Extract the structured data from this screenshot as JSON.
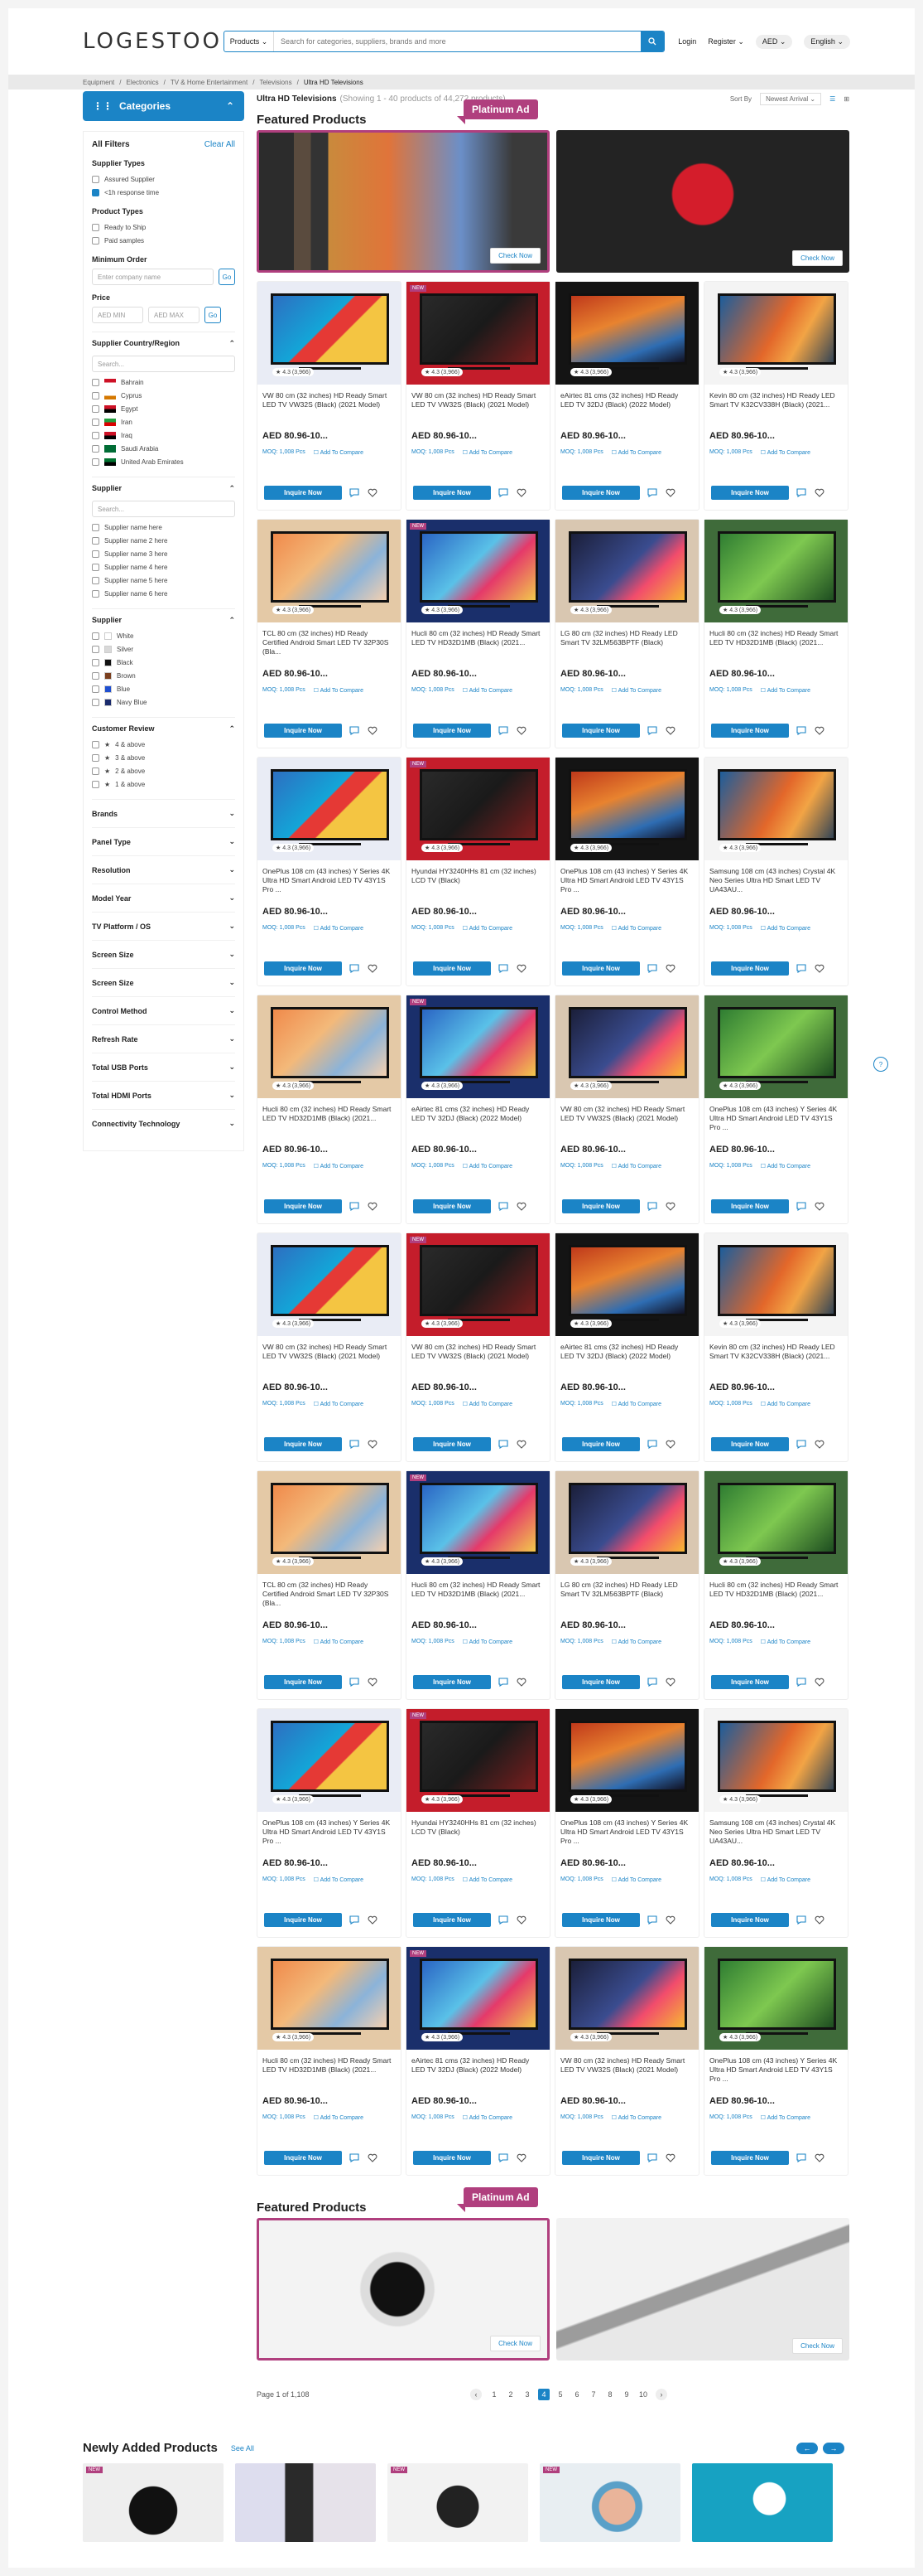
{
  "header": {
    "logo": "LOGESTOO",
    "search_scope": "Products",
    "search_placeholder": "Search for categories, suppliers, brands and more",
    "login": "Login",
    "register": "Register",
    "currency": "AED",
    "language": "English"
  },
  "breadcrumb": [
    "Equipment",
    "Electronics",
    "TV & Home Entertainment",
    "Televisions",
    "Ultra HD Televisions"
  ],
  "sidebar": {
    "categories": "Categories",
    "all_filters": "All Filters",
    "clear_all": "Clear All",
    "supplier_types": {
      "title": "Supplier Types",
      "items": [
        "Assured Supplier",
        "<1h response time"
      ]
    },
    "product_types": {
      "title": "Product Types",
      "items": [
        "Ready to Ship",
        "Paid samples"
      ]
    },
    "min_order": {
      "title": "Minimum Order",
      "placeholder": "Enter company name",
      "go": "Go"
    },
    "price": {
      "title": "Price",
      "min": "AED MIN",
      "max": "AED MAX",
      "go": "Go"
    },
    "country": {
      "title": "Supplier Country/Region",
      "search": "Search...",
      "items": [
        {
          "name": "Bahrain",
          "c1": "#ce1126",
          "c2": "#fff"
        },
        {
          "name": "Cyprus",
          "c1": "#fff",
          "c2": "#d57800"
        },
        {
          "name": "Egypt",
          "c1": "#ce1126",
          "c2": "#000"
        },
        {
          "name": "Iran",
          "c1": "#239f40",
          "c2": "#da0000"
        },
        {
          "name": "Iraq",
          "c1": "#ce1126",
          "c2": "#000"
        },
        {
          "name": "Saudi Arabia",
          "c1": "#006c35",
          "c2": "#006c35"
        },
        {
          "name": "United Arab Emirates",
          "c1": "#00732f",
          "c2": "#000"
        }
      ]
    },
    "supplier": {
      "title": "Supplier",
      "search": "Search...",
      "items": [
        "Supplier name here",
        "Supplier name 2 here",
        "Supplier name 3 here",
        "Supplier name 4 here",
        "Supplier name 5 here",
        "Supplier name 6 here"
      ]
    },
    "color": {
      "title": "Supplier",
      "items": [
        {
          "name": "White",
          "hex": "#ffffff"
        },
        {
          "name": "Silver",
          "hex": "#d9d9d9"
        },
        {
          "name": "Black",
          "hex": "#111111"
        },
        {
          "name": "Brown",
          "hex": "#7b3f1e"
        },
        {
          "name": "Blue",
          "hex": "#1f4fd1"
        },
        {
          "name": "Navy Blue",
          "hex": "#1a2a6c"
        }
      ]
    },
    "review": {
      "title": "Customer Review",
      "items": [
        "4 & above",
        "3 & above",
        "2 & above",
        "1 & above"
      ]
    },
    "collapsed": [
      "Brands",
      "Panel Type",
      "Resolution",
      "Model Year",
      "TV Platform / OS",
      "Screen Size",
      "Screen Size",
      "Control Method",
      "Refresh Rate",
      "Total USB Ports",
      "Total HDMI Ports",
      "Connectivity Technology"
    ]
  },
  "main": {
    "title": "Ultra HD Televisions",
    "count": "(Showing 1 - 40 products of 44,272 products)",
    "sort_label": "Sort By",
    "sort_value": "Newest Arrival",
    "featured": "Featured Products",
    "platinum": "Platinum Ad",
    "check_now": "Check Now",
    "inquire": "Inquire Now",
    "moq": "MOQ: 1,008 Pcs",
    "compare": "Add To Compare",
    "rating": "4.3 (3,966)",
    "new_badge": "NEW",
    "price": "AED 80.96-10..."
  },
  "products": [
    "VW 80 cm (32 inches) HD Ready Smart LED TV VW32S (Black) (2021 Model)",
    "VW 80 cm (32 inches) HD Ready Smart LED TV VW32S (Black) (2021 Model)",
    "eAirtec 81 cms (32 inches) HD Ready LED TV 32DJ (Black) (2022 Model)",
    "Kevin 80 cm (32 inches) HD Ready LED Smart TV K32CV338H (Black) (2021...",
    "TCL 80 cm (32 inches) HD Ready Certified Android Smart LED TV 32P30S (Bla...",
    "Hucli 80 cm (32 inches) HD Ready Smart LED TV HD32D1MB (Black) (2021...",
    "LG 80 cm (32 inches) HD Ready LED Smart TV 32LM563BPTF (Black)",
    "Hucli 80 cm (32 inches) HD Ready Smart LED TV HD32D1MB (Black) (2021...",
    "OnePlus 108 cm (43 inches) Y Series 4K Ultra HD Smart Android LED TV 43Y1S Pro ...",
    "Hyundai HY3240HHs 81 cm (32 inches) LCD TV (Black)",
    "OnePlus 108 cm (43 inches) Y Series 4K Ultra HD Smart Android LED TV 43Y1S Pro ...",
    "Samsung 108 cm (43 inches) Crystal 4K Neo Series Ultra HD Smart LED TV UA43AU...",
    "Hucli 80 cm (32 inches) HD Ready Smart LED TV HD32D1MB (Black) (2021...",
    "eAirtec 81 cms (32 inches) HD Ready LED TV 32DJ (Black) (2022 Model)",
    "VW 80 cm (32 inches) HD Ready Smart LED TV VW32S (Black) (2021 Model)",
    "OnePlus 108 cm (43 inches) Y Series 4K Ultra HD Smart Android LED TV 43Y1S Pro ...",
    "VW 80 cm (32 inches) HD Ready Smart LED TV VW32S (Black) (2021 Model)",
    "VW 80 cm (32 inches) HD Ready Smart LED TV VW32S (Black) (2021 Model)",
    "eAirtec 81 cms (32 inches) HD Ready LED TV 32DJ (Black) (2022 Model)",
    "Kevin 80 cm (32 inches) HD Ready LED Smart TV K32CV338H (Black) (2021...",
    "TCL 80 cm (32 inches) HD Ready Certified Android Smart LED TV 32P30S (Bla...",
    "Hucli 80 cm (32 inches) HD Ready Smart LED TV HD32D1MB (Black) (2021...",
    "LG 80 cm (32 inches) HD Ready LED Smart TV 32LM563BPTF (Black)",
    "Hucli 80 cm (32 inches) HD Ready Smart LED TV HD32D1MB (Black) (2021...",
    "OnePlus 108 cm (43 inches) Y Series 4K Ultra HD Smart Android LED TV 43Y1S Pro ...",
    "Hyundai HY3240HHs 81 cm (32 inches) LCD TV (Black)",
    "OnePlus 108 cm (43 inches) Y Series 4K Ultra HD Smart Android LED TV 43Y1S Pro ...",
    "Samsung 108 cm (43 inches) Crystal 4K Neo Series Ultra HD Smart LED TV UA43AU...",
    "Hucli 80 cm (32 inches) HD Ready Smart LED TV HD32D1MB (Black) (2021...",
    "eAirtec 81 cms (32 inches) HD Ready LED TV 32DJ (Black) (2022 Model)",
    "VW 80 cm (32 inches) HD Ready Smart LED TV VW32S (Black) (2021 Model)",
    "OnePlus 108 cm (43 inches) Y Series 4K Ultra HD Smart Android LED TV 43Y1S Pro ..."
  ],
  "pagination": {
    "label": "Page 1 of 1,108",
    "pages": [
      "1",
      "2",
      "3",
      "4",
      "5",
      "6",
      "7",
      "8",
      "9",
      "10"
    ]
  },
  "newly": {
    "title": "Newly Added Products",
    "see_all": "See All"
  }
}
